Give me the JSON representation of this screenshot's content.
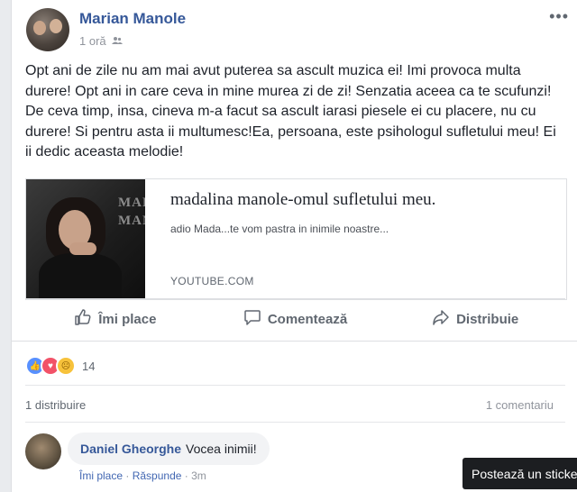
{
  "post": {
    "author": "Marian Manole",
    "time": "1 oră",
    "privacy_icon": "friends-icon",
    "text": "Opt ani de zile nu am mai avut puterea sa ascult muzica ei! Imi provoca multa durere! Opt ani in care ceva in mine murea zi de zi! Senzatia aceea ca te scufunzi! De ceva timp, insa, cineva m-a facut sa ascult iarasi piesele ei cu placere, nu cu durere! Si pentru asta ii multumesc!Ea, persoana, este psihologul sufletului meu! Ei ii dedic aceasta melodie!",
    "more_icon": "more-options-icon"
  },
  "link": {
    "thumb_text": "MADA\nMAN",
    "title": "madalina manole-omul sufletului meu.",
    "description": "adio Mada...te vom pastra in inimile noastre...",
    "domain": "YOUTUBE.COM"
  },
  "actions": {
    "like": "Îmi place",
    "comment": "Comentează",
    "share": "Distribuie"
  },
  "stats": {
    "reactions_count": "14",
    "shares": "1 distribuire",
    "comments": "1 comentariu"
  },
  "comment": {
    "author": "Daniel Gheorghe",
    "text": "Vocea inimii!",
    "like": "Îmi place",
    "separator": " · ",
    "reply": "Răspunde",
    "time": "3m"
  },
  "tooltip": {
    "text": "Postează un sticker"
  },
  "colors": {
    "link_blue": "#365899",
    "like_blue": "#5890ff",
    "love_red": "#f25268",
    "sad_yellow": "#f7c23b"
  }
}
